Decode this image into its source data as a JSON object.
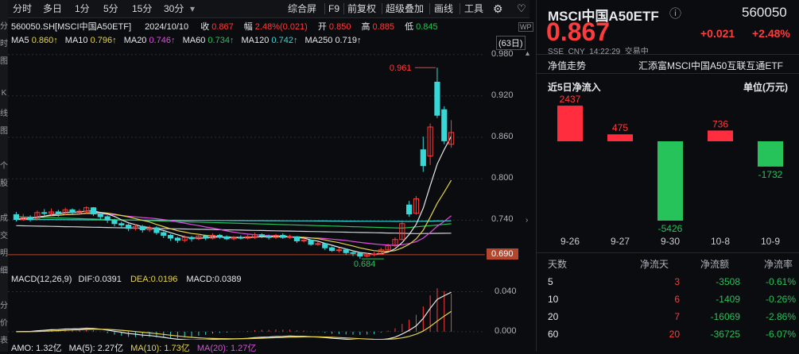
{
  "left_strip": [
    "分",
    "时",
    "图",
    "",
    "K",
    "线",
    "图",
    "",
    "个",
    "股",
    "",
    "成",
    "交",
    "明",
    "细",
    "",
    "分",
    "价",
    "表"
  ],
  "toolbar": {
    "items": [
      "分时",
      "多日",
      "1分",
      "5分",
      "15分",
      "30分"
    ],
    "right_items": [
      "综合屏",
      "F9",
      "前复权",
      "超级叠加",
      "画线",
      "工具"
    ],
    "icons": [
      "settings-icon",
      "heart-icon"
    ]
  },
  "stock_line": {
    "code": "560050.SH[MSCI中国A50ETF]",
    "date": "2024/10/10",
    "close_label": "收",
    "close": "0.867",
    "change_label": "幅",
    "change": "2.48%(0.021)",
    "open_label": "开",
    "open": "0.850",
    "high_label": "高",
    "high": "0.885",
    "low_label": "低",
    "low": "0.845"
  },
  "ma_line": {
    "ma5_label": "MA5",
    "ma5": "0.860↑",
    "ma10_label": "MA10",
    "ma10": "0.796↑",
    "ma20_label": "MA20",
    "ma20": "0.746↑",
    "ma60_label": "MA60",
    "ma60": "0.734↑",
    "ma120_label": "MA120",
    "ma120": "0.742↑",
    "ma250_label": "MA250",
    "ma250": "0.719↑",
    "days": "(63日)"
  },
  "chart_data": [
    {
      "type": "candlestick",
      "y_ticks": [
        "0.980",
        "0.920",
        "0.860",
        "0.800",
        "0.740"
      ],
      "ylim": [
        0.668,
        0.99
      ],
      "current_price_tag": "0.690",
      "annotations": {
        "high_label": "0.961",
        "low_label": "0.684"
      },
      "candles": [
        [
          0.748,
          0.741,
          0.752,
          0.738
        ],
        [
          0.741,
          0.744,
          0.749,
          0.739
        ],
        [
          0.744,
          0.742,
          0.747,
          0.738
        ],
        [
          0.742,
          0.751,
          0.754,
          0.74
        ],
        [
          0.751,
          0.75,
          0.756,
          0.746
        ],
        [
          0.75,
          0.752,
          0.757,
          0.747
        ],
        [
          0.752,
          0.749,
          0.755,
          0.745
        ],
        [
          0.749,
          0.755,
          0.758,
          0.747
        ],
        [
          0.755,
          0.751,
          0.757,
          0.748
        ],
        [
          0.751,
          0.753,
          0.756,
          0.749
        ],
        [
          0.753,
          0.758,
          0.76,
          0.75
        ],
        [
          0.758,
          0.749,
          0.759,
          0.746
        ],
        [
          0.749,
          0.745,
          0.751,
          0.741
        ],
        [
          0.745,
          0.74,
          0.747,
          0.736
        ],
        [
          0.74,
          0.735,
          0.742,
          0.731
        ],
        [
          0.735,
          0.733,
          0.738,
          0.729
        ],
        [
          0.733,
          0.728,
          0.735,
          0.724
        ],
        [
          0.728,
          0.731,
          0.734,
          0.725
        ],
        [
          0.731,
          0.726,
          0.733,
          0.722
        ],
        [
          0.726,
          0.729,
          0.732,
          0.723
        ],
        [
          0.729,
          0.722,
          0.731,
          0.719
        ],
        [
          0.722,
          0.718,
          0.724,
          0.714
        ],
        [
          0.718,
          0.714,
          0.72,
          0.71
        ],
        [
          0.714,
          0.711,
          0.716,
          0.707
        ],
        [
          0.711,
          0.715,
          0.718,
          0.708
        ],
        [
          0.715,
          0.713,
          0.717,
          0.709
        ],
        [
          0.713,
          0.717,
          0.72,
          0.711
        ],
        [
          0.717,
          0.714,
          0.719,
          0.711
        ],
        [
          0.714,
          0.718,
          0.721,
          0.712
        ],
        [
          0.718,
          0.716,
          0.72,
          0.713
        ],
        [
          0.716,
          0.713,
          0.718,
          0.711
        ],
        [
          0.713,
          0.715,
          0.717,
          0.711
        ],
        [
          0.715,
          0.714,
          0.718,
          0.712
        ],
        [
          0.714,
          0.716,
          0.719,
          0.712
        ],
        [
          0.716,
          0.719,
          0.722,
          0.713
        ],
        [
          0.719,
          0.717,
          0.721,
          0.714
        ],
        [
          0.717,
          0.715,
          0.719,
          0.712
        ],
        [
          0.715,
          0.718,
          0.72,
          0.713
        ],
        [
          0.718,
          0.715,
          0.721,
          0.713
        ],
        [
          0.715,
          0.716,
          0.719,
          0.713
        ],
        [
          0.716,
          0.71,
          0.717,
          0.707
        ],
        [
          0.71,
          0.711,
          0.714,
          0.708
        ],
        [
          0.711,
          0.705,
          0.712,
          0.703
        ],
        [
          0.705,
          0.706,
          0.709,
          0.703
        ],
        [
          0.706,
          0.7,
          0.707,
          0.697
        ],
        [
          0.7,
          0.696,
          0.702,
          0.694
        ],
        [
          0.696,
          0.697,
          0.7,
          0.693
        ],
        [
          0.697,
          0.693,
          0.699,
          0.69
        ],
        [
          0.693,
          0.692,
          0.696,
          0.688
        ],
        [
          0.692,
          0.688,
          0.694,
          0.684
        ],
        [
          0.688,
          0.69,
          0.693,
          0.686
        ],
        [
          0.69,
          0.691,
          0.694,
          0.688
        ],
        [
          0.691,
          0.697,
          0.7,
          0.69
        ],
        [
          0.697,
          0.703,
          0.706,
          0.695
        ],
        [
          0.703,
          0.712,
          0.715,
          0.701
        ],
        [
          0.712,
          0.735,
          0.738,
          0.711
        ],
        [
          0.762,
          0.749,
          0.768,
          0.745
        ],
        [
          0.75,
          0.771,
          0.775,
          0.748
        ],
        [
          0.842,
          0.819,
          0.861,
          0.81
        ],
        [
          0.833,
          0.875,
          0.88,
          0.82
        ],
        [
          0.94,
          0.892,
          0.961,
          0.888
        ],
        [
          0.9,
          0.855,
          0.905,
          0.85
        ],
        [
          0.85,
          0.867,
          0.885,
          0.845
        ]
      ]
    },
    {
      "type": "macd",
      "title": "MACD(12,26,9)",
      "DIF": "0.0391",
      "DEA": "0.0196",
      "MACD": "0.0389",
      "y_ticks": [
        "0.040",
        "0.000"
      ]
    }
  ],
  "macd_line": {
    "title": "MACD(12,26,9)",
    "dif_label": "DIF:",
    "dif": "0.0391",
    "dea_label": "DEA:",
    "dea": "0.0196",
    "macd_label": "MACD:",
    "macd": "0.0389"
  },
  "amo_line": {
    "amo": "AMO: 1.32亿",
    "ma5": "MA(5): 2.27亿",
    "ma10": "MA(10): 1.73亿",
    "ma20": "MA(20): 1.27亿"
  },
  "right": {
    "name": "MSCI中国A50ETF",
    "code": "560050",
    "price": "0.867",
    "change": "+0.021",
    "change_pct": "+2.48%",
    "sub": [
      "SSE",
      "CNY",
      "14:22:29",
      "交易中"
    ],
    "tab": "净值走势",
    "fund_name": "汇添富MSCI中国A50互联互通ETF",
    "flow_title": "近5日净流入",
    "unit": "单位(万元)",
    "flows": [
      {
        "date": "9-26",
        "value": 2437
      },
      {
        "date": "9-27",
        "value": 475
      },
      {
        "date": "9-30",
        "value": -5426
      },
      {
        "date": "10-8",
        "value": 736
      },
      {
        "date": "10-9",
        "value": -1732
      }
    ],
    "table_headers": [
      "天数",
      "净流天",
      "净流额",
      "净流率"
    ],
    "table_rows": [
      [
        "5",
        "3",
        "-3508",
        "-0.61%"
      ],
      [
        "10",
        "6",
        "-1409",
        "-0.26%"
      ],
      [
        "20",
        "7",
        "-16069",
        "-2.86%"
      ],
      [
        "60",
        "20",
        "-36725",
        "-6.07%"
      ]
    ]
  }
}
